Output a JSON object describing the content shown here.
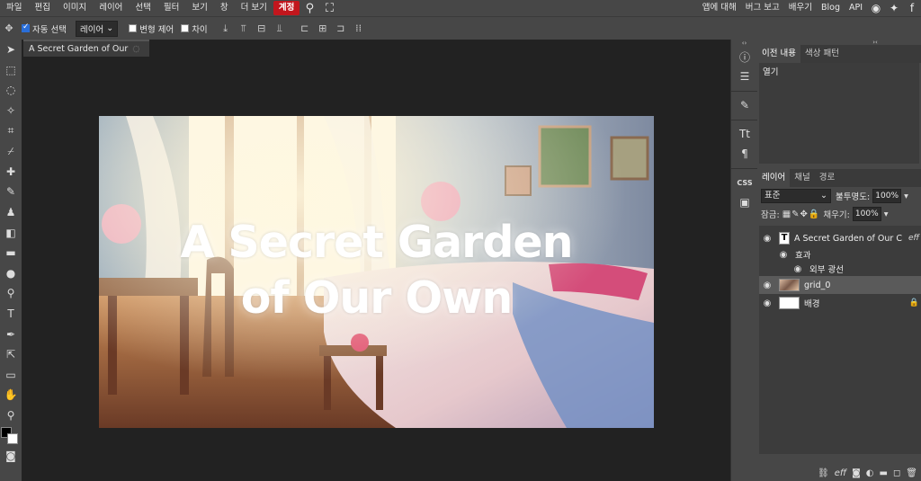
{
  "menu": {
    "items": [
      "파일",
      "편집",
      "이미지",
      "레이어",
      "선택",
      "필터",
      "보기",
      "창",
      "더 보기"
    ],
    "account": "계정",
    "right_links": [
      "앱에 대해",
      "버그 보고",
      "배우기",
      "Blog",
      "API"
    ]
  },
  "options": {
    "auto_select": "자동 선택",
    "auto_select_checked": true,
    "layer_select": "레이어",
    "transform": "변형 제어",
    "distance": "차이"
  },
  "document": {
    "tab_title": "A Secret Garden of Our",
    "artwork_title_line1": "A Secret Garden",
    "artwork_title_line2": "of Our Own"
  },
  "history_panel": {
    "tabs": [
      "이전 내용",
      "색상 패턴"
    ],
    "entries": [
      "열기"
    ]
  },
  "layers_panel": {
    "tabs": [
      "레이어",
      "채널",
      "경로"
    ],
    "blend_mode": "표준",
    "opacity_label": "불투명도:",
    "opacity_value": "100%",
    "lock_label": "잠금:",
    "fill_label": "채우기:",
    "fill_value": "100%",
    "layers": [
      {
        "name": "A Secret Garden of Our C",
        "type": "text",
        "fx": "eff"
      },
      {
        "name": "효과",
        "type": "sub"
      },
      {
        "name": "외부 광선",
        "type": "subsub"
      },
      {
        "name": "grid_0",
        "type": "image"
      },
      {
        "name": "배경",
        "type": "background"
      }
    ],
    "footer_fx": "eff"
  }
}
